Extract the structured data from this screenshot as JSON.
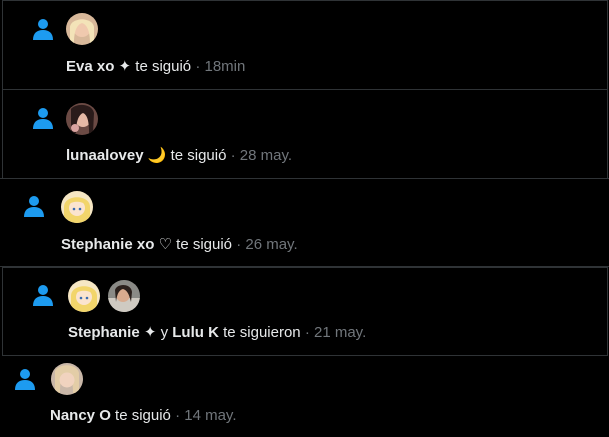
{
  "accent_color": "#1d9bf0",
  "notifications": [
    {
      "avatars": [
        "avatar-blonde-woman"
      ],
      "name": "Eva xo ✦",
      "conj": "",
      "name2": "",
      "action": "te siguió",
      "time": "· 18min"
    },
    {
      "avatars": [
        "avatar-dark-hair-woman"
      ],
      "name": "lunaalovey 🌙",
      "conj": "",
      "name2": "",
      "action": "te siguió",
      "time": "· 28 may."
    },
    {
      "avatars": [
        "avatar-anime-blonde"
      ],
      "name": "Stephanie xo ♡",
      "conj": "",
      "name2": "",
      "action": "te siguió",
      "time": "· 26 may."
    },
    {
      "avatars": [
        "avatar-anime-blonde",
        "avatar-dark-hair-woman"
      ],
      "name": "Stephanie ✦",
      "conj": "y",
      "name2": "Lulu K",
      "action": "te siguieron",
      "time": "· 21 may."
    },
    {
      "avatars": [
        "avatar-light-hair-woman"
      ],
      "name": "Nancy O",
      "conj": "",
      "name2": "",
      "action": "te siguió",
      "time": "· 14 may."
    }
  ]
}
